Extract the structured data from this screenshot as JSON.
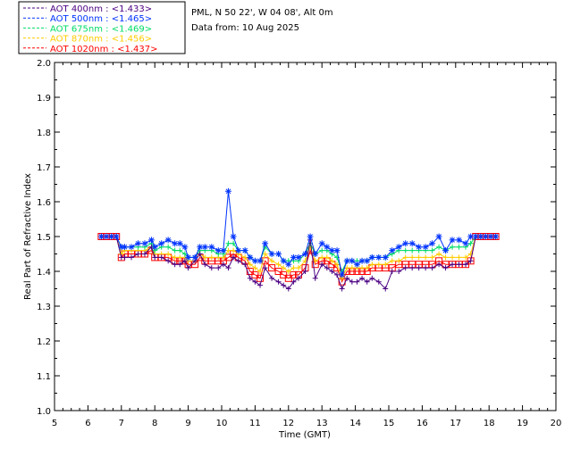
{
  "legend": [
    {
      "label": "AOT  400nm : <1.433>",
      "color": "#4b0082"
    },
    {
      "label": "AOT  500nm : <1.465>",
      "color": "#0033ff"
    },
    {
      "label": "AOT  675nm : <1.469>",
      "color": "#00dd66"
    },
    {
      "label": "AOT  870nm : <1.456>",
      "color": "#ffcc00"
    },
    {
      "label": "AOT 1020nm : <1.437>",
      "color": "#ff0000"
    }
  ],
  "info": {
    "line1": "PML, N 50 22', W 04 08', Alt 0m",
    "line2": "Data from: 10 Aug 2025"
  },
  "chart_data": {
    "type": "line",
    "xlabel": "Time (GMT)",
    "ylabel": "Real Part of Refractive Index",
    "xlim": [
      5,
      20
    ],
    "ylim": [
      1.0,
      2.0
    ],
    "xticks": [
      "5",
      "6",
      "7",
      "8",
      "9",
      "10",
      "11",
      "12",
      "13",
      "14",
      "15",
      "16",
      "17",
      "18",
      "19",
      "20"
    ],
    "yticks": [
      "1.0",
      "1.1",
      "1.2",
      "1.3",
      "1.4",
      "1.5",
      "1.6",
      "1.7",
      "1.8",
      "1.9",
      "2.0"
    ],
    "x": [
      6.4,
      6.55,
      6.7,
      6.85,
      7.0,
      7.1,
      7.3,
      7.5,
      7.7,
      7.9,
      8.0,
      8.2,
      8.4,
      8.6,
      8.75,
      8.9,
      9.0,
      9.2,
      9.35,
      9.5,
      9.7,
      9.9,
      10.05,
      10.2,
      10.35,
      10.5,
      10.7,
      10.85,
      11.0,
      11.15,
      11.3,
      11.5,
      11.7,
      11.85,
      12.0,
      12.15,
      12.3,
      12.5,
      12.65,
      12.8,
      13.0,
      13.15,
      13.3,
      13.45,
      13.6,
      13.75,
      13.9,
      14.05,
      14.2,
      14.35,
      14.5,
      14.7,
      14.9,
      15.1,
      15.3,
      15.5,
      15.7,
      15.9,
      16.1,
      16.3,
      16.5,
      16.7,
      16.9,
      17.1,
      17.3,
      17.45,
      17.6,
      17.75,
      17.9,
      18.05,
      18.2
    ],
    "series": [
      {
        "name": "AOT  400nm",
        "marker": "plus",
        "values": [
          1.5,
          1.5,
          1.5,
          1.5,
          1.44,
          1.44,
          1.44,
          1.45,
          1.45,
          1.47,
          1.44,
          1.44,
          1.43,
          1.42,
          1.42,
          1.43,
          1.41,
          1.43,
          1.45,
          1.42,
          1.41,
          1.41,
          1.42,
          1.41,
          1.44,
          1.43,
          1.42,
          1.38,
          1.37,
          1.36,
          1.41,
          1.38,
          1.37,
          1.36,
          1.35,
          1.37,
          1.38,
          1.4,
          1.49,
          1.38,
          1.42,
          1.41,
          1.4,
          1.39,
          1.35,
          1.38,
          1.37,
          1.37,
          1.38,
          1.37,
          1.38,
          1.37,
          1.35,
          1.4,
          1.4,
          1.41,
          1.41,
          1.41,
          1.41,
          1.41,
          1.42,
          1.41,
          1.42,
          1.42,
          1.42,
          1.43,
          1.5,
          1.5,
          1.5,
          1.5,
          1.5
        ]
      },
      {
        "name": "AOT  500nm",
        "marker": "star",
        "values": [
          1.5,
          1.5,
          1.5,
          1.5,
          1.47,
          1.47,
          1.47,
          1.48,
          1.48,
          1.49,
          1.47,
          1.48,
          1.49,
          1.48,
          1.48,
          1.47,
          1.44,
          1.44,
          1.47,
          1.47,
          1.47,
          1.46,
          1.46,
          1.63,
          1.5,
          1.46,
          1.46,
          1.44,
          1.43,
          1.43,
          1.48,
          1.45,
          1.45,
          1.43,
          1.42,
          1.44,
          1.44,
          1.45,
          1.5,
          1.45,
          1.48,
          1.47,
          1.46,
          1.46,
          1.39,
          1.43,
          1.43,
          1.42,
          1.43,
          1.43,
          1.44,
          1.44,
          1.44,
          1.46,
          1.47,
          1.48,
          1.48,
          1.47,
          1.47,
          1.48,
          1.5,
          1.46,
          1.49,
          1.49,
          1.48,
          1.5,
          1.5,
          1.5,
          1.5,
          1.5,
          1.5
        ]
      },
      {
        "name": "AOT  675nm",
        "marker": "plus",
        "values": [
          1.5,
          1.5,
          1.5,
          1.5,
          1.47,
          1.47,
          1.47,
          1.47,
          1.47,
          1.48,
          1.46,
          1.47,
          1.47,
          1.46,
          1.46,
          1.45,
          1.44,
          1.44,
          1.46,
          1.46,
          1.46,
          1.45,
          1.45,
          1.48,
          1.48,
          1.46,
          1.46,
          1.44,
          1.43,
          1.43,
          1.47,
          1.45,
          1.45,
          1.43,
          1.43,
          1.43,
          1.43,
          1.45,
          1.48,
          1.45,
          1.46,
          1.46,
          1.45,
          1.44,
          1.4,
          1.43,
          1.43,
          1.43,
          1.43,
          1.43,
          1.44,
          1.44,
          1.44,
          1.45,
          1.46,
          1.46,
          1.46,
          1.46,
          1.46,
          1.46,
          1.47,
          1.46,
          1.47,
          1.47,
          1.47,
          1.48,
          1.5,
          1.5,
          1.5,
          1.5,
          1.5
        ]
      },
      {
        "name": "AOT  870nm",
        "marker": "plus",
        "values": [
          1.5,
          1.5,
          1.5,
          1.5,
          1.45,
          1.46,
          1.46,
          1.46,
          1.46,
          1.47,
          1.45,
          1.45,
          1.45,
          1.44,
          1.44,
          1.44,
          1.43,
          1.43,
          1.45,
          1.44,
          1.44,
          1.44,
          1.44,
          1.46,
          1.46,
          1.45,
          1.44,
          1.42,
          1.41,
          1.4,
          1.45,
          1.43,
          1.42,
          1.41,
          1.4,
          1.41,
          1.41,
          1.43,
          1.47,
          1.43,
          1.44,
          1.44,
          1.43,
          1.42,
          1.38,
          1.41,
          1.41,
          1.41,
          1.41,
          1.41,
          1.42,
          1.42,
          1.42,
          1.43,
          1.43,
          1.44,
          1.44,
          1.44,
          1.44,
          1.44,
          1.45,
          1.44,
          1.44,
          1.44,
          1.44,
          1.45,
          1.5,
          1.5,
          1.5,
          1.5,
          1.5
        ]
      },
      {
        "name": "AOT 1020nm",
        "marker": "square",
        "values": [
          1.5,
          1.5,
          1.5,
          1.5,
          1.44,
          1.45,
          1.45,
          1.45,
          1.45,
          1.46,
          1.44,
          1.44,
          1.44,
          1.43,
          1.43,
          1.43,
          1.42,
          1.42,
          1.44,
          1.43,
          1.43,
          1.43,
          1.43,
          1.44,
          1.45,
          1.44,
          1.43,
          1.4,
          1.39,
          1.38,
          1.43,
          1.41,
          1.4,
          1.39,
          1.38,
          1.39,
          1.39,
          1.41,
          1.46,
          1.42,
          1.43,
          1.43,
          1.42,
          1.41,
          1.37,
          1.4,
          1.4,
          1.4,
          1.4,
          1.4,
          1.41,
          1.41,
          1.41,
          1.41,
          1.42,
          1.42,
          1.42,
          1.42,
          1.42,
          1.42,
          1.43,
          1.42,
          1.42,
          1.42,
          1.42,
          1.43,
          1.5,
          1.5,
          1.5,
          1.5,
          1.5
        ]
      }
    ]
  }
}
